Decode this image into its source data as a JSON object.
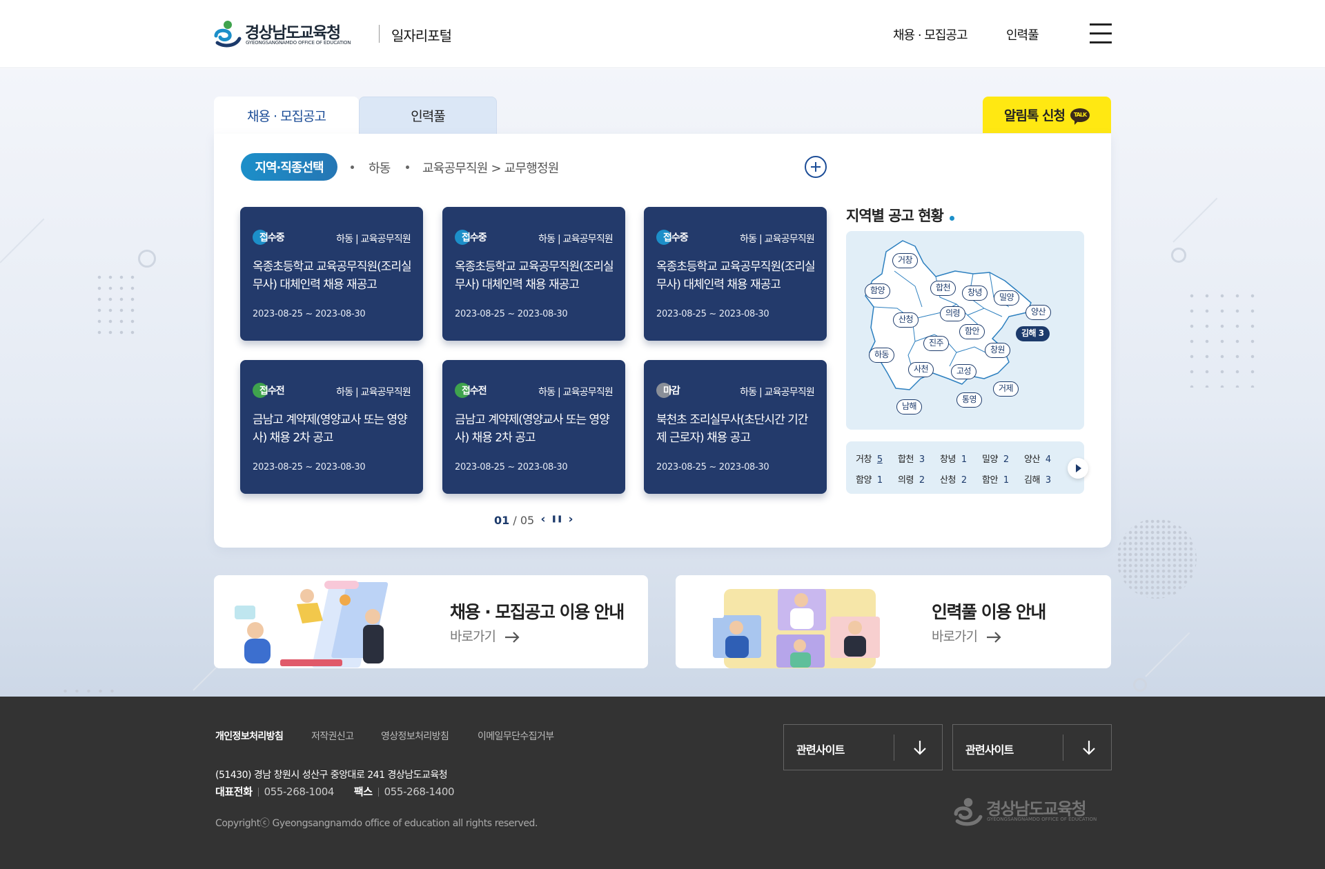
{
  "header": {
    "logo_ko": "경상남도교육청",
    "logo_en": "GYEONGSANGNAMDO OFFICE OF EDUCATION",
    "site_name": "일자리포털",
    "nav": [
      "채용 · 모집공고",
      "인력풀"
    ],
    "menu_icon": "hamburger-icon"
  },
  "tabs": {
    "active": "채용 · 모집공고",
    "inactive": "인력풀",
    "kakao_button": "알림톡 신청",
    "kakao_badge": "TALK"
  },
  "filter": {
    "pill": "지역·직종선택",
    "items": [
      "하동",
      "교육공무직원 > 교무행정원"
    ],
    "add_icon": "plus-circle-icon"
  },
  "jobs": [
    {
      "status": "접수중",
      "status_color": "#1c8fc9",
      "region": "하동 | 교육공무직원",
      "title": "옥종초등학교 교육공무직원(조리실무사) 대체인력 채용 재공고",
      "date": "2023-08-25 ~ 2023-08-30"
    },
    {
      "status": "접수중",
      "status_color": "#1c8fc9",
      "region": "하동 | 교육공무직원",
      "title": "옥종초등학교 교육공무직원(조리실무사) 대체인력 채용 재공고",
      "date": "2023-08-25 ~ 2023-08-30"
    },
    {
      "status": "접수중",
      "status_color": "#1c8fc9",
      "region": "하동 | 교육공무직원",
      "title": "옥종초등학교 교육공무직원(조리실무사) 대체인력 채용 재공고",
      "date": "2023-08-25 ~ 2023-08-30"
    },
    {
      "status": "접수전",
      "status_color": "#3fa34d",
      "region": "하동 | 교육공무직원",
      "title": "금남고 계약제(영양교사 또는 영양사) 채용 2차 공고",
      "date": "2023-08-25 ~ 2023-08-30"
    },
    {
      "status": "접수전",
      "status_color": "#3fa34d",
      "region": "하동 | 교육공무직원",
      "title": "금남고 계약제(영양교사 또는 영양사) 채용 2차 공고",
      "date": "2023-08-25 ~ 2023-08-30"
    },
    {
      "status": "마감",
      "status_color": "#8a8f98",
      "region": "하동 | 교육공무직원",
      "title": "북천초 조리실무사(초단시간 기간제 근로자) 채용 공고",
      "date": "2023-08-25 ~ 2023-08-30"
    }
  ],
  "pager": {
    "current": "01",
    "total": "/ 05",
    "prev": "‹",
    "pause": "❚❚",
    "next": "›"
  },
  "map": {
    "title": "지역별 공고 현황",
    "regions": [
      "거창",
      "함양",
      "합천",
      "창녕",
      "밀양",
      "양산",
      "의령",
      "산청",
      "함안",
      "김해 3",
      "진주",
      "창원",
      "하동",
      "사천",
      "고성",
      "거제",
      "통영",
      "남해"
    ],
    "active_region": "김해 3"
  },
  "stats": [
    {
      "name": "거창",
      "count": "5"
    },
    {
      "name": "합천",
      "count": "3"
    },
    {
      "name": "창녕",
      "count": "1"
    },
    {
      "name": "밀양",
      "count": "2"
    },
    {
      "name": "양산",
      "count": "4"
    },
    {
      "name": "함양",
      "count": "1"
    },
    {
      "name": "의령",
      "count": "2"
    },
    {
      "name": "산청",
      "count": "2"
    },
    {
      "name": "함안",
      "count": "1"
    },
    {
      "name": "김해",
      "count": "3"
    }
  ],
  "guides": [
    {
      "title": "채용 · 모집공고 이용 안내",
      "link": "바로가기"
    },
    {
      "title": "인력풀 이용 안내",
      "link": "바로가기"
    }
  ],
  "footer": {
    "links": [
      "개인정보처리방침",
      "저작권신고",
      "영상정보처리방침",
      "이메일무단수집거부"
    ],
    "address": "(51430) 경남 창원시 성산구 중앙대로 241 경상남도교육청",
    "phone_label": "대표전화",
    "phone": "055-268-1004",
    "fax_label": "팩스",
    "fax": "055-268-1400",
    "copyright": "Copyrightⓒ Gyeongsangnamdo office of education all rights reserved.",
    "related_sites": [
      "관련사이트",
      "관련사이트"
    ],
    "logo_ko": "경상남도교육청",
    "logo_en": "GYEONGSANGNAMDO OFFICE OF EDUCATION"
  }
}
